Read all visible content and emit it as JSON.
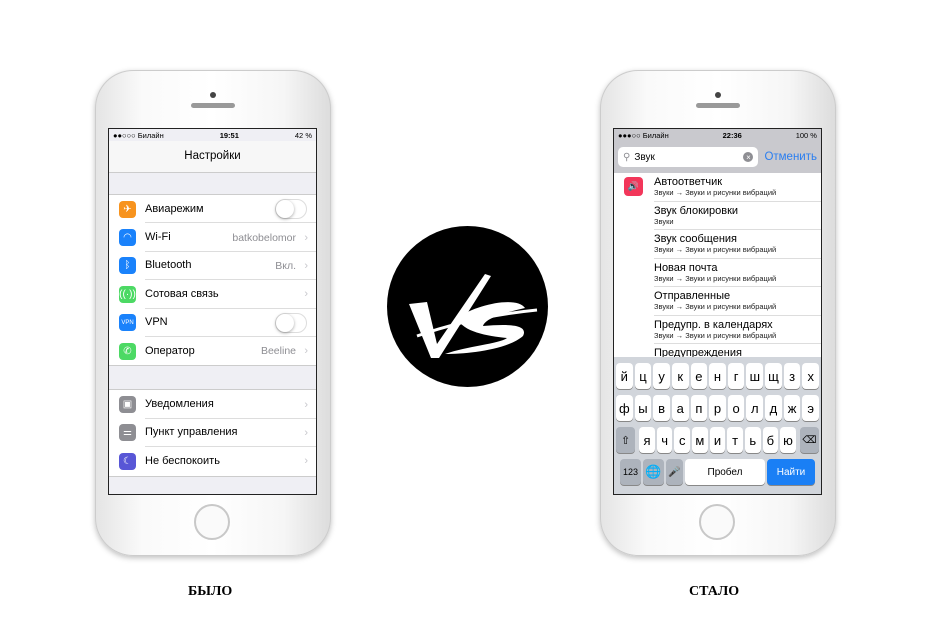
{
  "left": {
    "caption": "БЫЛО",
    "status": {
      "carrier": "●●○○○ Билайн",
      "time": "19:51",
      "battery": "42 %"
    },
    "title": "Настройки",
    "group1": [
      {
        "label": "Авиарежим",
        "icon": "airplane-icon",
        "color": "#f7931e",
        "toggle": true
      },
      {
        "label": "Wi-Fi",
        "value": "batkobelomor",
        "icon": "wifi-icon",
        "color": "#1a82fb"
      },
      {
        "label": "Bluetooth",
        "value": "Вкл.",
        "icon": "bluetooth-icon",
        "color": "#1a82fb"
      },
      {
        "label": "Сотовая связь",
        "icon": "cellular-icon",
        "color": "#4cd964"
      },
      {
        "label": "VPN",
        "icon": "vpn-icon",
        "color": "#1a82fb",
        "toggle": true,
        "icon_text": "VPN"
      },
      {
        "label": "Оператор",
        "value": "Beeline",
        "icon": "phone-icon",
        "color": "#4cd964"
      }
    ],
    "group2": [
      {
        "label": "Уведомления",
        "icon": "notifications-icon",
        "color": "#8e8e93"
      },
      {
        "label": "Пункт управления",
        "icon": "control-center-icon",
        "color": "#8e8e93"
      },
      {
        "label": "Не беспокоить",
        "icon": "moon-icon",
        "color": "#5856d6"
      }
    ]
  },
  "right": {
    "caption": "СТАЛО",
    "status": {
      "carrier": "●●●○○ Билайн",
      "time": "22:36",
      "battery": "100 %"
    },
    "search": {
      "value": "Звук",
      "cancel": "Отменить"
    },
    "results": [
      {
        "title": "Автоответчик",
        "sub": "Звуки → Звуки и рисунки вибраций"
      },
      {
        "title": "Звук блокировки",
        "sub": "Звуки"
      },
      {
        "title": "Звук сообщения",
        "sub": "Звуки → Звуки и рисунки вибраций"
      },
      {
        "title": "Новая почта",
        "sub": "Звуки → Звуки и рисунки вибраций"
      },
      {
        "title": "Отправленные",
        "sub": "Звуки → Звуки и рисунки вибраций"
      },
      {
        "title": "Предупр. в календарях",
        "sub": "Звуки → Звуки и рисунки вибраций"
      },
      {
        "title": "Предупреждения",
        "sub": ""
      }
    ],
    "keyboard": {
      "row1": [
        "й",
        "ц",
        "у",
        "к",
        "е",
        "н",
        "г",
        "ш",
        "щ",
        "з",
        "х"
      ],
      "row2": [
        "ф",
        "ы",
        "в",
        "а",
        "п",
        "р",
        "о",
        "л",
        "д",
        "ж",
        "э"
      ],
      "row3": [
        "я",
        "ч",
        "с",
        "м",
        "и",
        "т",
        "ь",
        "б",
        "ю"
      ],
      "num": "123",
      "space": "Пробел",
      "go": "Найти"
    }
  },
  "vs_logo": "VS"
}
